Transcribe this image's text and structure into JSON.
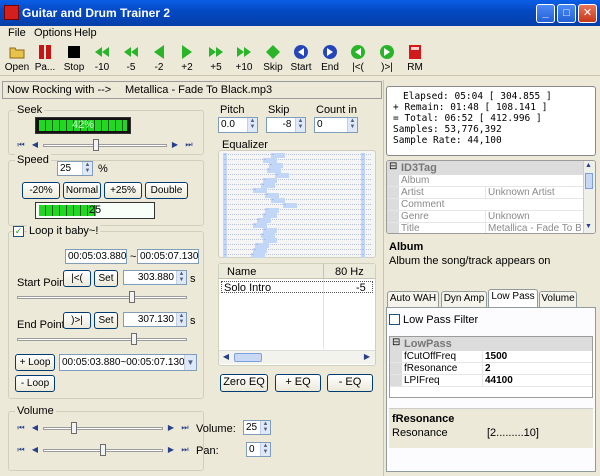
{
  "window": {
    "title": "Guitar and Drum Trainer 2",
    "min": "_",
    "max": "□",
    "close": "✕"
  },
  "menu": [
    "File",
    "Options",
    "Help"
  ],
  "toolbar": [
    {
      "label": "Open",
      "icon": "folder-icon"
    },
    {
      "label": "Pa...",
      "icon": "pause-icon"
    },
    {
      "label": "Stop",
      "icon": "stop-icon"
    },
    {
      "label": "-10",
      "icon": "rewind-icon"
    },
    {
      "label": "-5",
      "icon": "rewind-icon"
    },
    {
      "label": "-2",
      "icon": "back-icon"
    },
    {
      "label": "+2",
      "icon": "forward-icon"
    },
    {
      "label": "+5",
      "icon": "fast-forward-icon"
    },
    {
      "label": "+10",
      "icon": "fast-forward-icon"
    },
    {
      "label": "Skip",
      "icon": "skip-icon"
    },
    {
      "label": "Start",
      "icon": "start-icon"
    },
    {
      "label": "End",
      "icon": "end-icon"
    },
    {
      "label": "|<(",
      "icon": "loop-start-icon"
    },
    {
      "label": ")>|",
      "icon": "loop-end-icon"
    },
    {
      "label": "RM",
      "icon": "rm-icon"
    }
  ],
  "now": {
    "label": "Now Rocking with -->",
    "track": "Metallica - Fade To Black.mp3"
  },
  "seek": {
    "title": "Seek",
    "percent": "42%",
    "position": 0.42
  },
  "speed": {
    "title": "Speed",
    "value": "25",
    "unit": "%",
    "btns": [
      "-20%",
      "Normal",
      "+25%",
      "Double"
    ],
    "display": "25",
    "level": 0.5
  },
  "loop": {
    "check": "✓",
    "title": "Loop it baby~!",
    "from": "00:05:03.880",
    "sep": "~",
    "to": "00:05:07.130",
    "start_label": "Start Point",
    "start_btn1": "|<(",
    "start_btn2": "Set",
    "start_val": "303.880",
    "start_unit": "s",
    "end_label": "End Point",
    "end_btn1": ")>|",
    "end_btn2": "Set",
    "end_val": "307.130",
    "end_unit": "s",
    "add_btn": "+ Loop",
    "list_val": "00:05:03.880~00:05:07.130",
    "remove_btn": "- Loop"
  },
  "volume": {
    "title": "Volume",
    "vol_label": "Volume:",
    "vol_val": "25",
    "pan_label": "Pan:",
    "pan_val": "0"
  },
  "pitch": {
    "label": "Pitch",
    "val": "0.0"
  },
  "skip": {
    "label": "Skip",
    "val": "-8"
  },
  "count": {
    "label": "Count in",
    "val": "0"
  },
  "eq": {
    "title": "Equalizer",
    "col_name": "Name",
    "col_hz": "80 Hz",
    "rows": [
      {
        "name": "Solo Intro",
        "hz": "-5"
      }
    ],
    "zero": "Zero EQ",
    "add": "+ EQ",
    "remove": "- EQ"
  },
  "info": {
    "elapsed": "Elapsed: 05:04 [ 304.855 ]",
    "remain": "+ Remain: 01:48 [ 108.141 ]",
    "total": "=  Total: 06:52 [ 412.996 ]",
    "samples": "Samples: 53,776,392",
    "rate": "Sample Rate: 44,100"
  },
  "id3": {
    "header": "ID3Tag",
    "rows": [
      {
        "k": "Album",
        "v": ""
      },
      {
        "k": "Artist",
        "v": "Unknown Artist"
      },
      {
        "k": "Comment",
        "v": ""
      },
      {
        "k": "Genre",
        "v": "Unknown"
      },
      {
        "k": "Title",
        "v": "Metallica - Fade To Bl"
      }
    ],
    "desc_title": "Album",
    "desc": "Album the song/track appears on"
  },
  "tabs": [
    "Auto WAH",
    "Dyn Amp",
    "Low Pass",
    "Volume"
  ],
  "lowpass": {
    "check": "Low Pass Filter",
    "header": "LowPass",
    "rows": [
      {
        "k": "fCutOffFreq",
        "v": "1500"
      },
      {
        "k": "fResonance",
        "v": "2"
      },
      {
        "k": "LPIFreq",
        "v": "44100"
      }
    ],
    "desc_title": "fResonance",
    "desc_k": "Resonance",
    "desc_v": "[2.........10]"
  },
  "colors": {
    "title": "#0449c4",
    "meter": "#22d722",
    "panel": "#ece9d8"
  }
}
